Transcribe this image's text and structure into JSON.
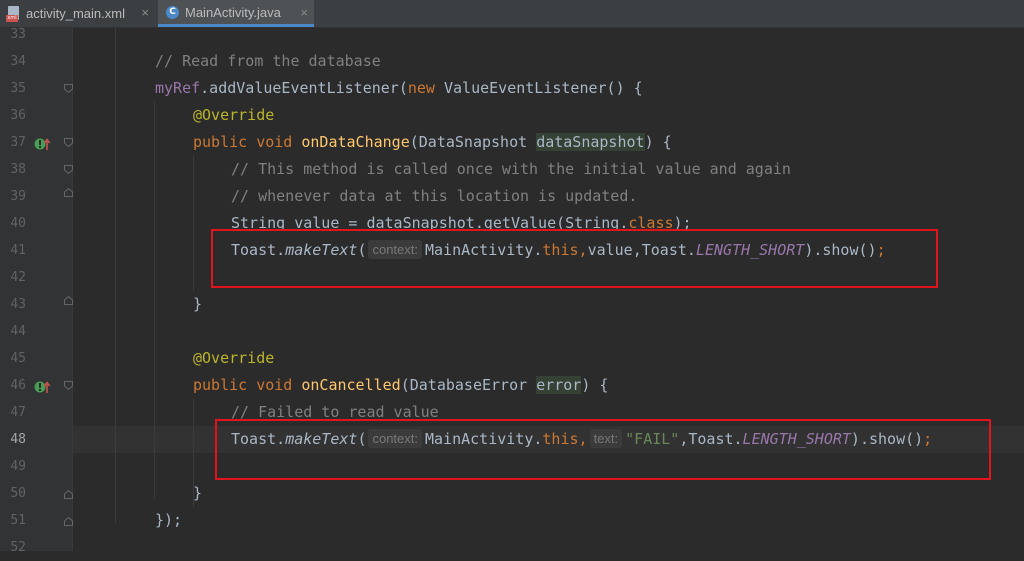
{
  "tabs": [
    {
      "label": "activity_main.xml",
      "icon": "xml-file-icon",
      "active": false
    },
    {
      "label": "MainActivity.java",
      "icon": "java-class-icon",
      "active": true
    }
  ],
  "close_glyph": "×",
  "line_numbers": [
    "33",
    "34",
    "35",
    "36",
    "37",
    "38",
    "39",
    "40",
    "41",
    "42",
    "43",
    "44",
    "45",
    "46",
    "47",
    "48",
    "49",
    "50",
    "51",
    "52"
  ],
  "current_line": "48",
  "code": {
    "l34": {
      "comment": "// Read from the database"
    },
    "l35": {
      "field": "myRef",
      "call": ".addValueEventListener(",
      "kw": "new",
      "rest": " ValueEventListener() {"
    },
    "l36": {
      "annotation": "@Override"
    },
    "l37": {
      "kw1": "public",
      "kw2": "void",
      "method": "onDataChange",
      "open": "(DataSnapshot ",
      "param": "dataSnapshot",
      "close": ") {"
    },
    "l38": {
      "comment": "// This method is called once with the initial value and again"
    },
    "l39": {
      "comment": "// whenever data at this location is updated."
    },
    "l40": {
      "text1": "String value = dataSnapshot.getValue(String.",
      "kw": "class",
      "text2": ");"
    },
    "l41": {
      "cls": "Toast.",
      "method": "makeText",
      "paren": "(",
      "hint": "context:",
      "arg1": "MainActivity.",
      "kw": "this",
      "sep": ",",
      "arg2": "value,Toast.",
      "const": "LENGTH_SHORT",
      "tail": ").show()",
      "semi": ";"
    },
    "l43": {
      "text": "}"
    },
    "l45": {
      "annotation": "@Override"
    },
    "l46": {
      "kw1": "public",
      "kw2": "void",
      "method": "onCancelled",
      "open": "(DatabaseError ",
      "param": "error",
      "close": ") {"
    },
    "l47": {
      "comment": "// Failed to read value"
    },
    "l48": {
      "cls": "Toast.",
      "method": "makeText",
      "paren": "(",
      "hint": "context:",
      "arg1": "MainActivity.",
      "kw": "this",
      "sep": ",",
      "hint2": "text:",
      "str": "\"FAIL\"",
      "arg2": ",Toast.",
      "const": "LENGTH_SHORT",
      "tail": ").show()",
      "semi": ";"
    },
    "l50": {
      "text": "}"
    },
    "l51": {
      "text": "});"
    }
  },
  "colors": {
    "background": "#2b2b2b",
    "gutter": "#313335",
    "keyword": "#cc7832",
    "comment": "#808080",
    "annotation": "#bbb529",
    "method": "#ffc66d",
    "string": "#6a8759",
    "field": "#9876aa",
    "highlight_box": "#e0141c"
  }
}
